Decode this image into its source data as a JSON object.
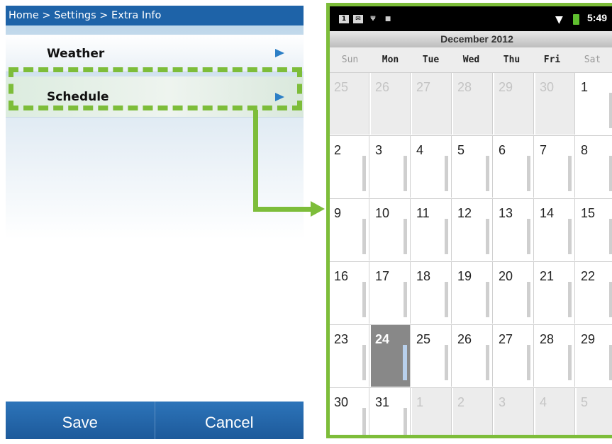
{
  "left_screen": {
    "breadcrumb": "Home > Settings > Extra Info",
    "menu_items": [
      {
        "label": "Weather"
      },
      {
        "label": "Schedule"
      }
    ],
    "buttons": {
      "save": "Save",
      "cancel": "Cancel"
    }
  },
  "right_screen": {
    "status_time": "5:49",
    "month": "December 2012",
    "weekdays": [
      "Sun",
      "Mon",
      "Tue",
      "Wed",
      "Thu",
      "Fri",
      "Sat"
    ],
    "today": "24",
    "weeks": [
      [
        {
          "d": "25",
          "other": true
        },
        {
          "d": "26",
          "other": true
        },
        {
          "d": "27",
          "other": true
        },
        {
          "d": "28",
          "other": true
        },
        {
          "d": "29",
          "other": true
        },
        {
          "d": "30",
          "other": true
        },
        {
          "d": "1"
        }
      ],
      [
        {
          "d": "2"
        },
        {
          "d": "3"
        },
        {
          "d": "4"
        },
        {
          "d": "5"
        },
        {
          "d": "6"
        },
        {
          "d": "7"
        },
        {
          "d": "8"
        }
      ],
      [
        {
          "d": "9"
        },
        {
          "d": "10"
        },
        {
          "d": "11"
        },
        {
          "d": "12"
        },
        {
          "d": "13"
        },
        {
          "d": "14"
        },
        {
          "d": "15"
        }
      ],
      [
        {
          "d": "16"
        },
        {
          "d": "17"
        },
        {
          "d": "18"
        },
        {
          "d": "19"
        },
        {
          "d": "20"
        },
        {
          "d": "21"
        },
        {
          "d": "22"
        }
      ],
      [
        {
          "d": "23"
        },
        {
          "d": "24"
        },
        {
          "d": "25"
        },
        {
          "d": "26"
        },
        {
          "d": "27"
        },
        {
          "d": "28"
        },
        {
          "d": "29"
        }
      ],
      [
        {
          "d": "30"
        },
        {
          "d": "31"
        },
        {
          "d": "1",
          "other": true
        },
        {
          "d": "2",
          "other": true
        },
        {
          "d": "3",
          "other": true
        },
        {
          "d": "4",
          "other": true
        },
        {
          "d": "5",
          "other": true
        }
      ]
    ]
  },
  "colors": {
    "accent_green": "#7dbd3a",
    "header_blue": "#1e63a8",
    "arrow_blue": "#2c7fc6"
  }
}
